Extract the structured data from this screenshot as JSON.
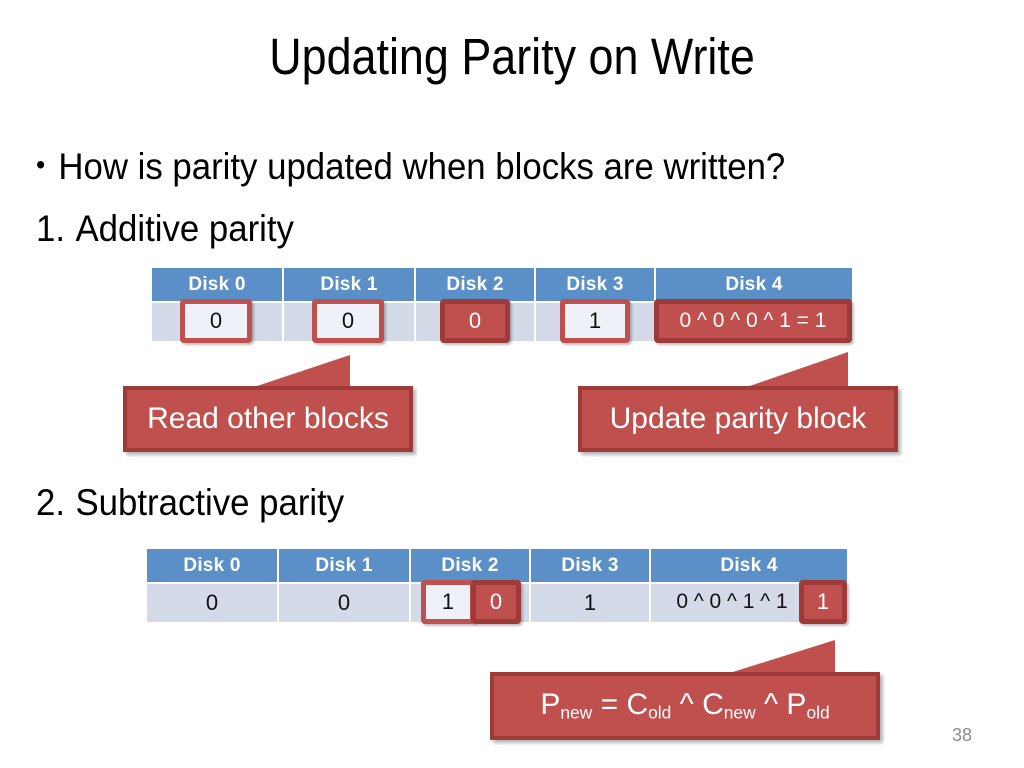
{
  "slide": {
    "title": "Updating Parity on Write",
    "page_number": "38",
    "bullet": {
      "marker": "•",
      "text": "How is parity updated when blocks are written?"
    },
    "items": [
      {
        "number": "1.",
        "label": "Additive parity"
      },
      {
        "number": "2.",
        "label": "Subtractive parity"
      }
    ]
  },
  "colors": {
    "header_blue": "#5b8fc7",
    "cell_blue_gray": "#d5dae8",
    "accent_red": "#c0504d",
    "accent_red_dark": "#9e3a38",
    "page_number_gray": "#8c8c8c"
  },
  "table_additive": {
    "headers": [
      "Disk 0",
      "Disk 1",
      "Disk 2",
      "Disk 3",
      "Disk 4"
    ],
    "values": [
      "0",
      "0",
      "0",
      "1",
      "0 ^ 0 ^ 0 ^ 1 = 1"
    ],
    "highlights": [
      {
        "cell": "Disk 0",
        "value": "0",
        "style": "open"
      },
      {
        "cell": "Disk 1",
        "value": "0",
        "style": "open"
      },
      {
        "cell": "Disk 2",
        "value": "0",
        "style": "solid"
      },
      {
        "cell": "Disk 3",
        "value": "1",
        "style": "open"
      },
      {
        "cell": "Disk 4",
        "value": "0 ^ 0 ^ 0 ^ 1 = 1",
        "style": "solid"
      }
    ]
  },
  "table_subtractive": {
    "headers": [
      "Disk 0",
      "Disk 1",
      "Disk 2",
      "Disk 3",
      "Disk 4"
    ],
    "values": [
      "0",
      "0",
      "1",
      "1",
      "0 ^ 0 ^ 1 ^ 1"
    ],
    "highlights": [
      {
        "cell": "Disk 2",
        "value": "1",
        "style": "open"
      },
      {
        "cell": "Disk 2",
        "value": "0",
        "style": "solid"
      },
      {
        "cell": "Disk 4",
        "value": "1",
        "style": "solid"
      }
    ]
  },
  "callouts": {
    "read": "Read other blocks",
    "update": "Update parity block",
    "formula_plain": "P_new = C_old ^ C_new ^ P_old",
    "formula_parts": {
      "p1": "P",
      "p1sub": "new",
      "eq": " = ",
      "c1": "C",
      "c1sub": "old",
      "op1": " ^ ",
      "c2": "C",
      "c2sub": "new",
      "op2": " ^ ",
      "p2": "P",
      "p2sub": "old"
    }
  }
}
